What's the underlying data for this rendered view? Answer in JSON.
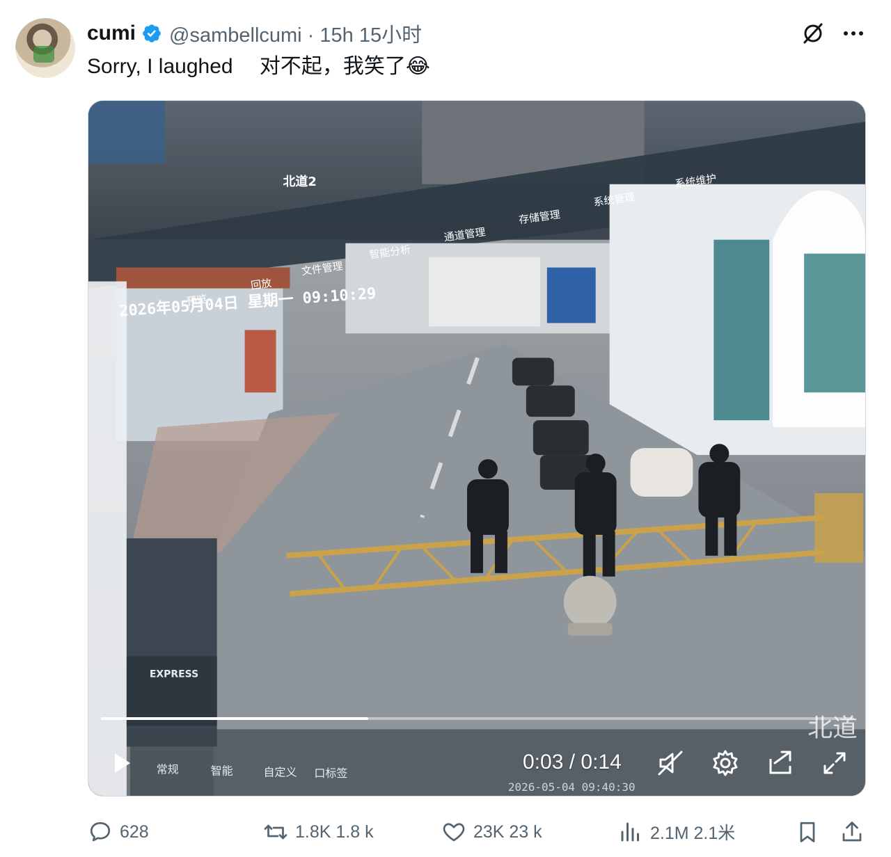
{
  "author": {
    "display_name": "cumi",
    "handle_time": "@sambellcumi · 15h 15小时"
  },
  "tweet": {
    "text": "Sorry, I laughed　 对不起，我笑了😂"
  },
  "video": {
    "time_display": "0:03 / 0:14",
    "progress_fraction": 0.355,
    "overlay": {
      "channel": "北道2",
      "osd_date": "2026年05月04日 星期一 09:10:29",
      "menu_items": [
        "预览",
        "回放",
        "文件管理",
        "智能分析",
        "通道管理",
        "存储管理",
        "系统管理",
        "系统维护"
      ],
      "bottom_labels": [
        "常规",
        "智能",
        "自定义",
        "口标签"
      ],
      "bottom_timestamp": "2026-05-04 09:40:30",
      "corner_label": "北道",
      "box_label": "EXPRESS"
    }
  },
  "stats": {
    "replies": "628",
    "reposts": "1.8K 1.8 k",
    "likes": "23K 23 k",
    "views": "2.1M 2.1米"
  },
  "colors": {
    "verified": "#1d9bf0",
    "secondary_text": "#536471"
  }
}
